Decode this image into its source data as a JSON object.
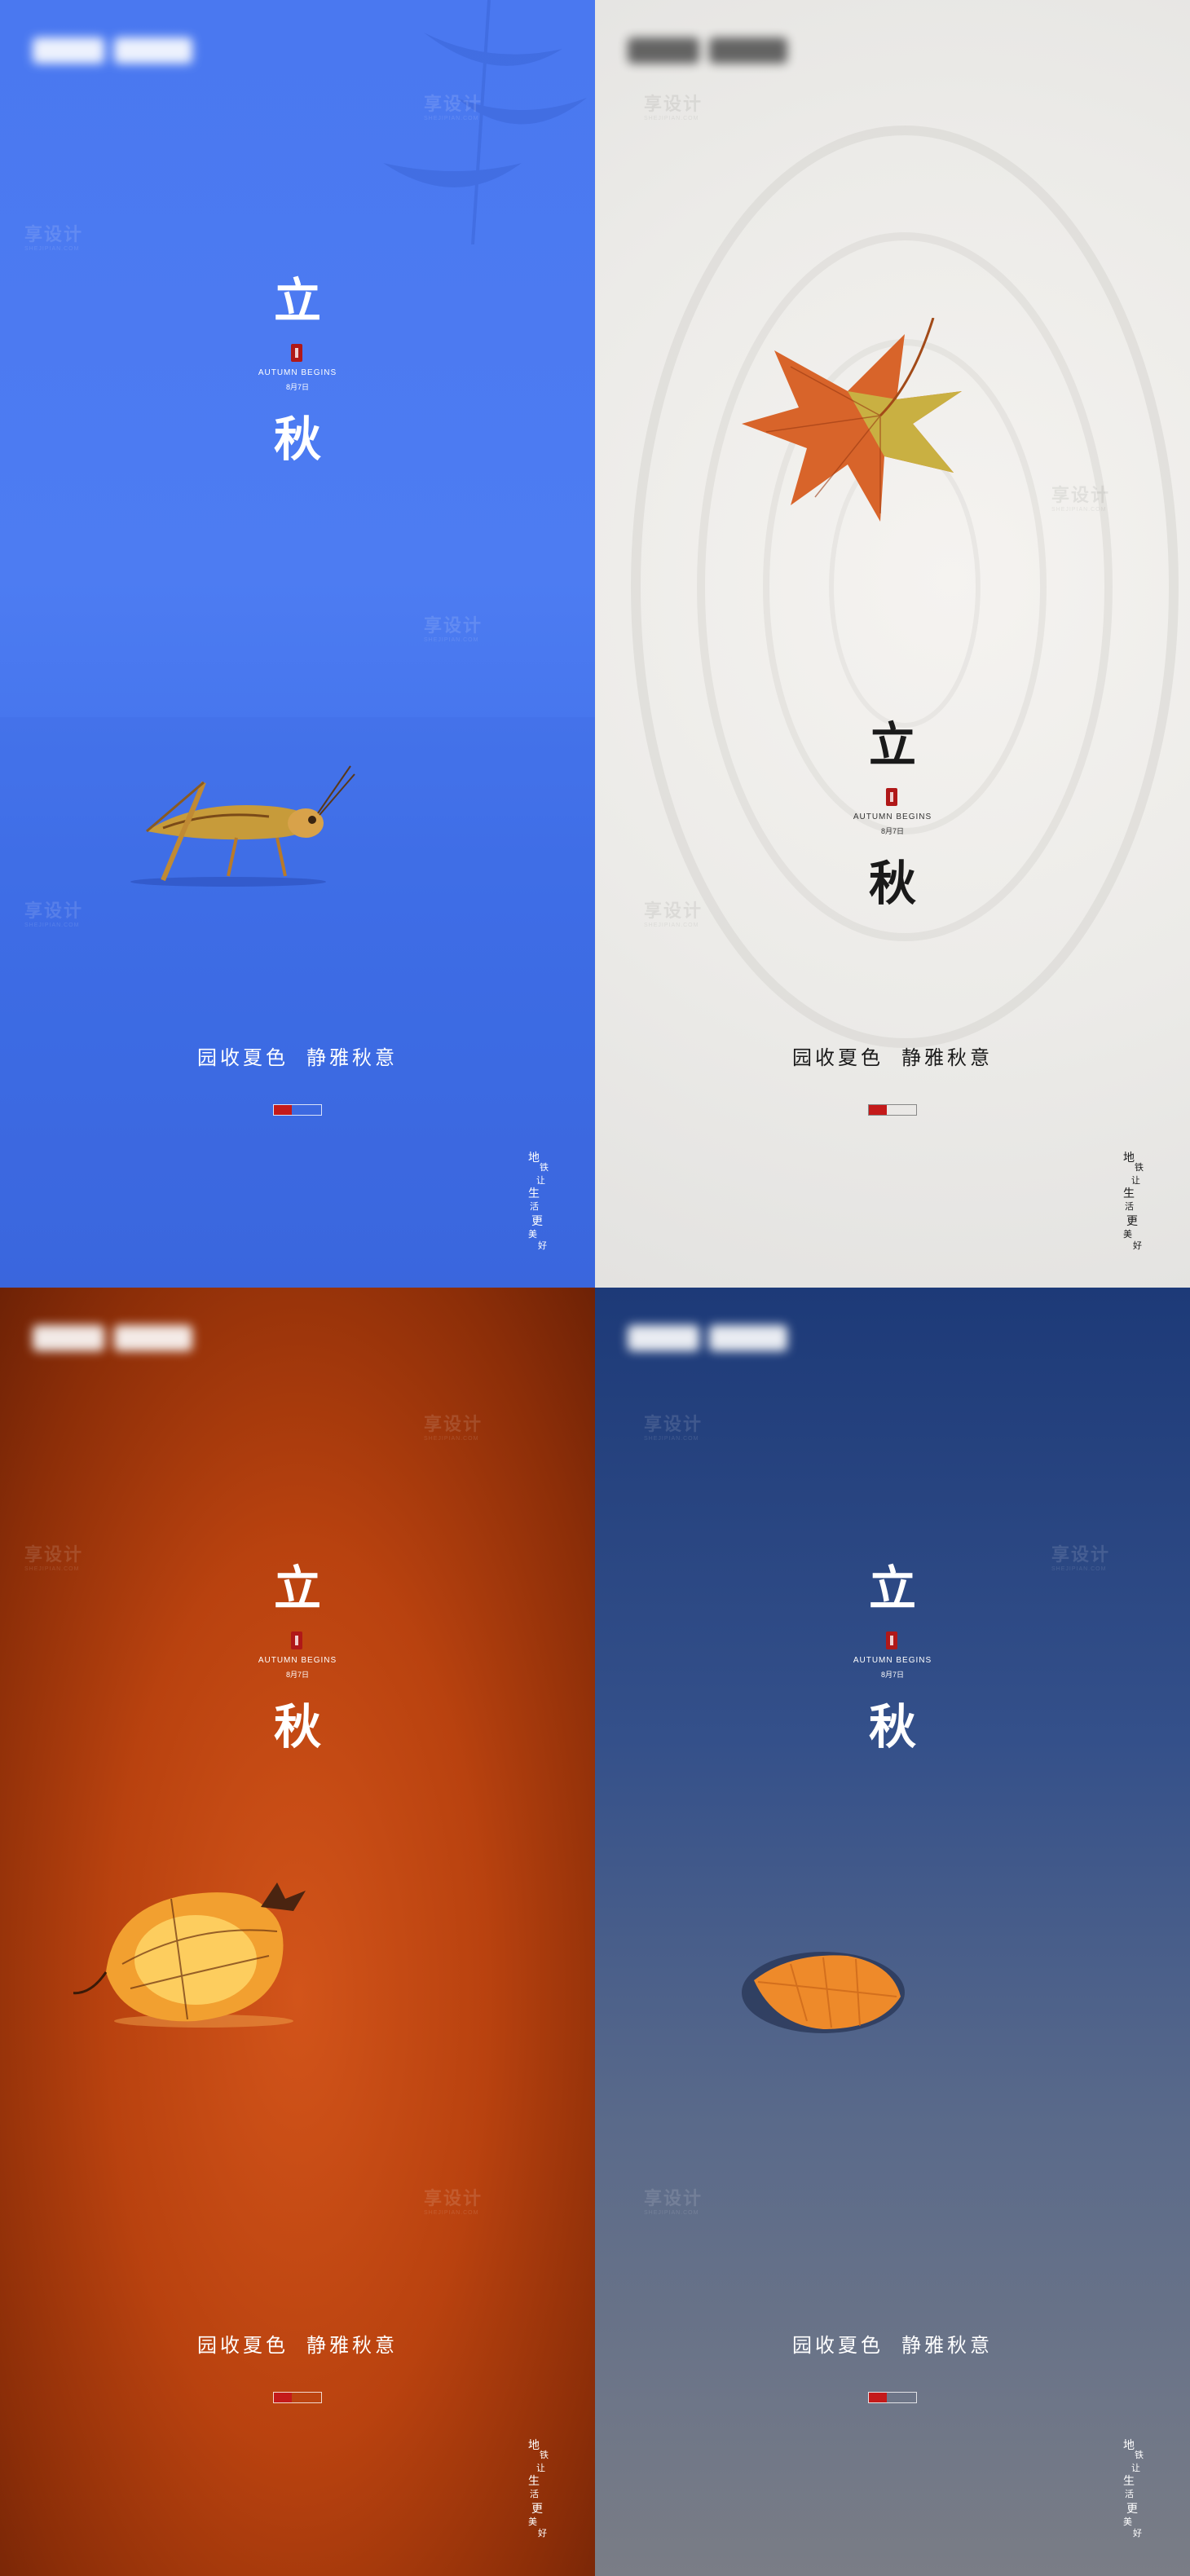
{
  "title_top": "立",
  "title_bottom": "秋",
  "english_caption": "AUTUMN BEGINS",
  "date_caption": "8月7日",
  "slogan_left": "园收夏色",
  "slogan_right": "静雅秋意",
  "vertical_chars": [
    "地",
    "铁",
    "让",
    "生",
    "活",
    "更",
    "美",
    "好"
  ],
  "watermark_text": "享设计",
  "watermark_sub": "SHEJIPIAN.COM",
  "posters": [
    {
      "name": "blue-grasshopper",
      "text_color": "#ffffff"
    },
    {
      "name": "white-maple-leaf",
      "text_color": "#1a1a1a"
    },
    {
      "name": "orange-lantern",
      "text_color": "#ffffff"
    },
    {
      "name": "navy-floating-leaf",
      "text_color": "#ffffff"
    }
  ],
  "colors": {
    "seal_red": "#b01818",
    "badge_red": "#c41a1a"
  }
}
